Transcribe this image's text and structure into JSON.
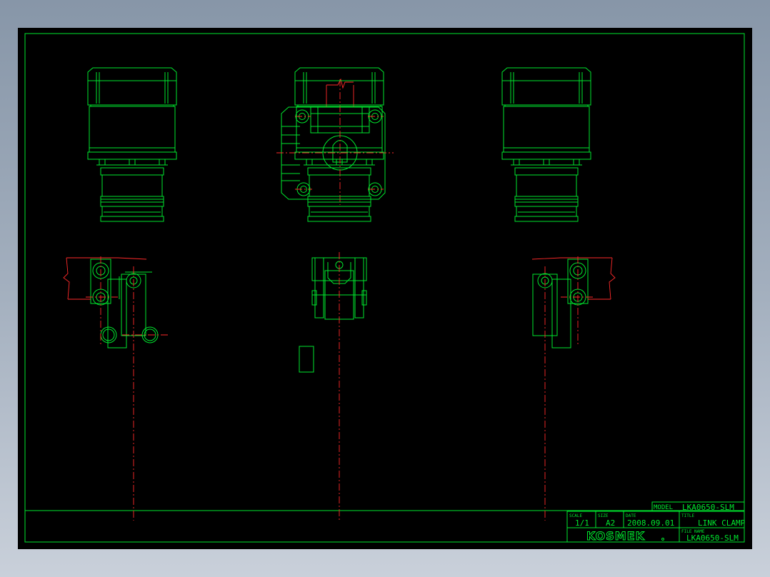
{
  "title_block": {
    "model_label": "MODEL",
    "model": "LKA0650-SLM",
    "scale_label": "SCALE",
    "scale": "1/1",
    "size_label": "SIZE",
    "size": "A2",
    "date_label": "DATE",
    "date": "2008.09.01",
    "title_label": "TITLE",
    "title": "LINK CLAMP",
    "filename_label": "FILE NAME",
    "filename": "LKA0650-SLM",
    "company": "KOSMEK"
  },
  "colors": {
    "background": "#000000",
    "outline": "#00e62e",
    "centerline": "#ff2a2a"
  }
}
